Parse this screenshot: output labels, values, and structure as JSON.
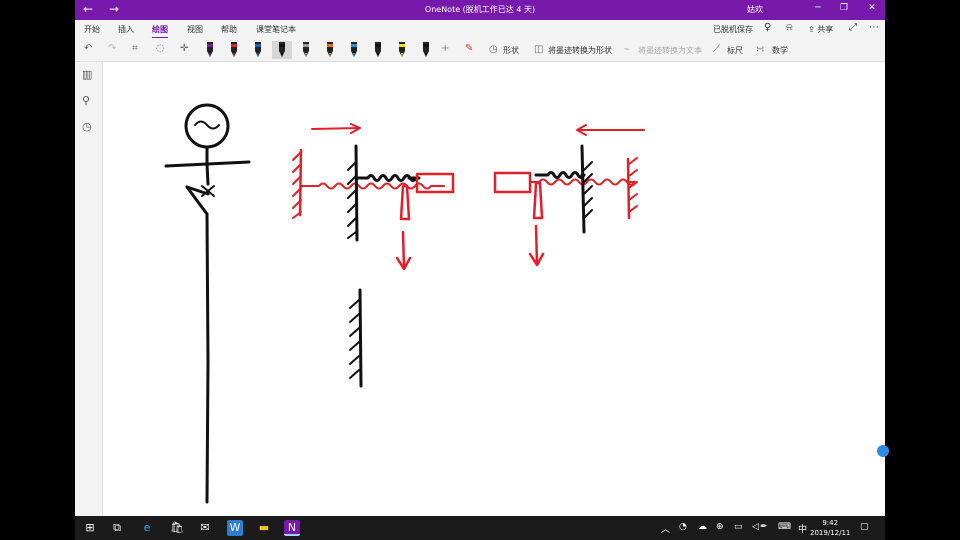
{
  "window": {
    "title": "OneNote (脱机工作已达 4 天)",
    "user": "姑欢",
    "back_icon": "arrow-left-icon",
    "forward_icon": "arrow-right-icon"
  },
  "menu": {
    "tabs": [
      "开始",
      "插入",
      "绘图",
      "视图",
      "帮助",
      "课堂笔记本"
    ],
    "active_tab": "绘图",
    "status": "已脱机保存",
    "share": "共享"
  },
  "toolbar": {
    "shape": "形状",
    "ink_to_shape": "将墨迹转换为形状",
    "ink_to_text": "将墨迹转换为文本",
    "ruler": "标尺",
    "math": "数学",
    "pen_colors": [
      "#7a1fa2",
      "#e02020",
      "#1a5fd0",
      "#111111",
      "#9e9e9e",
      "#e07020",
      "#2a8fe0",
      "#111111",
      "#f0e020",
      "#111111"
    ],
    "selected_pen_index": 3
  },
  "taskbar": {
    "time": "9:42",
    "date": "2019/12/11",
    "ime": "中"
  },
  "colors": {
    "accent": "#7719aa",
    "ink_black": "#111111",
    "ink_red": "#e0202a"
  }
}
